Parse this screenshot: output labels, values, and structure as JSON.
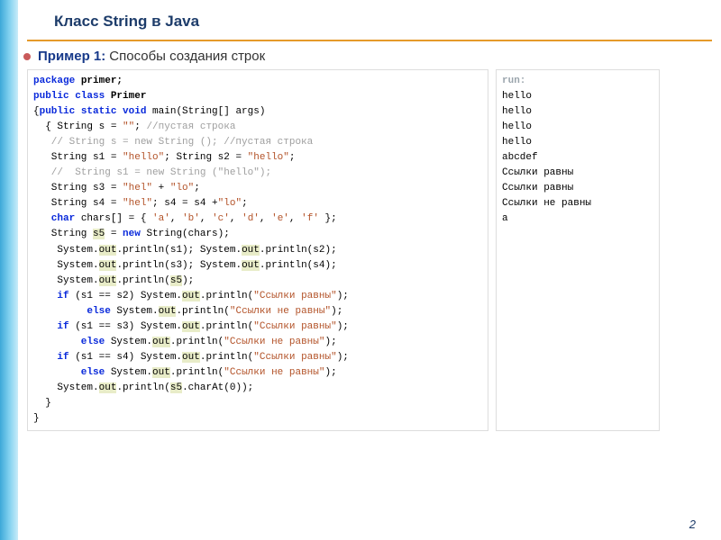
{
  "slide": {
    "title": "Класс  String в Java",
    "example_label": "Пример 1:",
    "example_text": "Способы создания строк",
    "page_number": "2"
  },
  "code": {
    "l01_kw": "package",
    "l01_tx": " primer;",
    "l02_kw": "public class",
    "l02_tx": " Primer",
    "l03_pre": "{",
    "l03_kw": "public static void",
    "l03_tx": " main(String[] args)",
    "l04_pre": "  { String s = ",
    "l04_str": "\"\"",
    "l04_tx": "; ",
    "l04_cm": "//пустая строка",
    "l05_cm": "   // String s = new String (); //пустая строка",
    "l06_pre": "   String s1 = ",
    "l06_s1": "\"hello\"",
    "l06_mid": "; String s2 = ",
    "l06_s2": "\"hello\"",
    "l06_end": ";",
    "l07_cm": "   //  String s1 = new String (\"hello\");",
    "l08_pre": "   String s3 = ",
    "l08_s1": "\"hel\"",
    "l08_mid": " + ",
    "l08_s2": "\"lo\"",
    "l08_end": ";",
    "l09_pre": "   String s4 = ",
    "l09_s1": "\"hel\"",
    "l09_mid": "; s4 = s4 +",
    "l09_s2": "\"lo\"",
    "l09_end": ";",
    "l10_kw": "   char",
    "l10_pre": " chars[] = { ",
    "l10_a": "'a'",
    "l10_c1": ", ",
    "l10_b": "'b'",
    "l10_c2": ", ",
    "l10_c": "'c'",
    "l10_c3": ", ",
    "l10_d": "'d'",
    "l10_c4": ", ",
    "l10_e": "'e'",
    "l10_c5": ", ",
    "l10_f": "'f'",
    "l10_end": " };",
    "l11_pre": "   String ",
    "l11_hl": "s5",
    "l11_mid": " = ",
    "l11_kw": "new",
    "l11_tx": " String(chars);",
    "l12_pre": "    System.",
    "l12_hl1": "out",
    "l12_m1": ".println(s1); System.",
    "l12_hl2": "out",
    "l12_end": ".println(s2);",
    "l13_pre": "    System.",
    "l13_hl1": "out",
    "l13_m1": ".println(s3); System.",
    "l13_hl2": "out",
    "l13_end": ".println(s4);",
    "l14_pre": "    System.",
    "l14_hl1": "out",
    "l14_m1": ".println(",
    "l14_hl2": "s5",
    "l14_end": ");",
    "l15_kw": "    if",
    "l15_pre": " (s1 == s2) System.",
    "l15_hl": "out",
    "l15_m": ".println(",
    "l15_str": "\"Ссылки равны\"",
    "l15_end": ");",
    "l16_kw": "         else",
    "l16_pre": " System.",
    "l16_hl": "out",
    "l16_m": ".println(",
    "l16_str": "\"Ссылки не равны\"",
    "l16_end": ");",
    "l17_kw": "    if",
    "l17_pre": " (s1 == s3) System.",
    "l17_hl": "out",
    "l17_m": ".println(",
    "l17_str": "\"Ссылки равны\"",
    "l17_end": ");",
    "l18_kw": "        else",
    "l18_pre": " System.",
    "l18_hl": "out",
    "l18_m": ".println(",
    "l18_str": "\"Ссылки не равны\"",
    "l18_end": ");",
    "l19_kw": "    if",
    "l19_pre": " (s1 == s4) System.",
    "l19_hl": "out",
    "l19_m": ".println(",
    "l19_str": "\"Ссылки равны\"",
    "l19_end": ");",
    "l20_kw": "        else",
    "l20_pre": " System.",
    "l20_hl": "out",
    "l20_m": ".println(",
    "l20_str": "\"Ссылки не равны\"",
    "l20_end": ");",
    "l21_pre": "    System.",
    "l21_hl1": "out",
    "l21_m1": ".println(",
    "l21_hl2": "s5",
    "l21_end": ".charAt(0));",
    "l22": "  }",
    "l23": "}"
  },
  "output": {
    "l0": "run:",
    "l1": "hello",
    "l2": "hello",
    "l3": "hello",
    "l4": "hello",
    "l5": "abcdef",
    "l6": "Ссылки равны",
    "l7": "Ссылки равны",
    "l8": "Ссылки не равны",
    "l9": "a"
  }
}
